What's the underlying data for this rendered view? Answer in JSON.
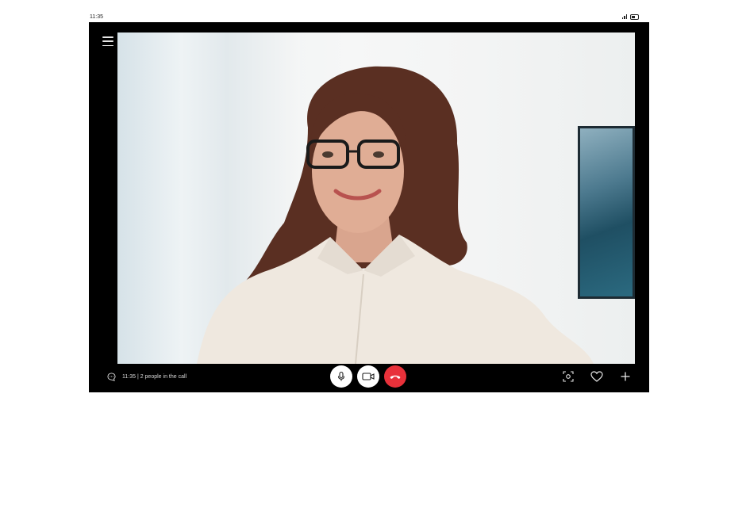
{
  "status_bar": {
    "time": "11:35"
  },
  "call": {
    "info_text": "11:35 | 2 people in the call"
  },
  "icons": {
    "menu": "menu-icon",
    "chat": "chat-icon",
    "mic": "microphone-icon",
    "camera": "video-camera-icon",
    "end_call": "end-call-icon",
    "screenshot": "camera-focus-icon",
    "like": "heart-icon",
    "add": "plus-icon"
  },
  "colors": {
    "end_call": "#e8313a",
    "device_frame": "#000000"
  }
}
